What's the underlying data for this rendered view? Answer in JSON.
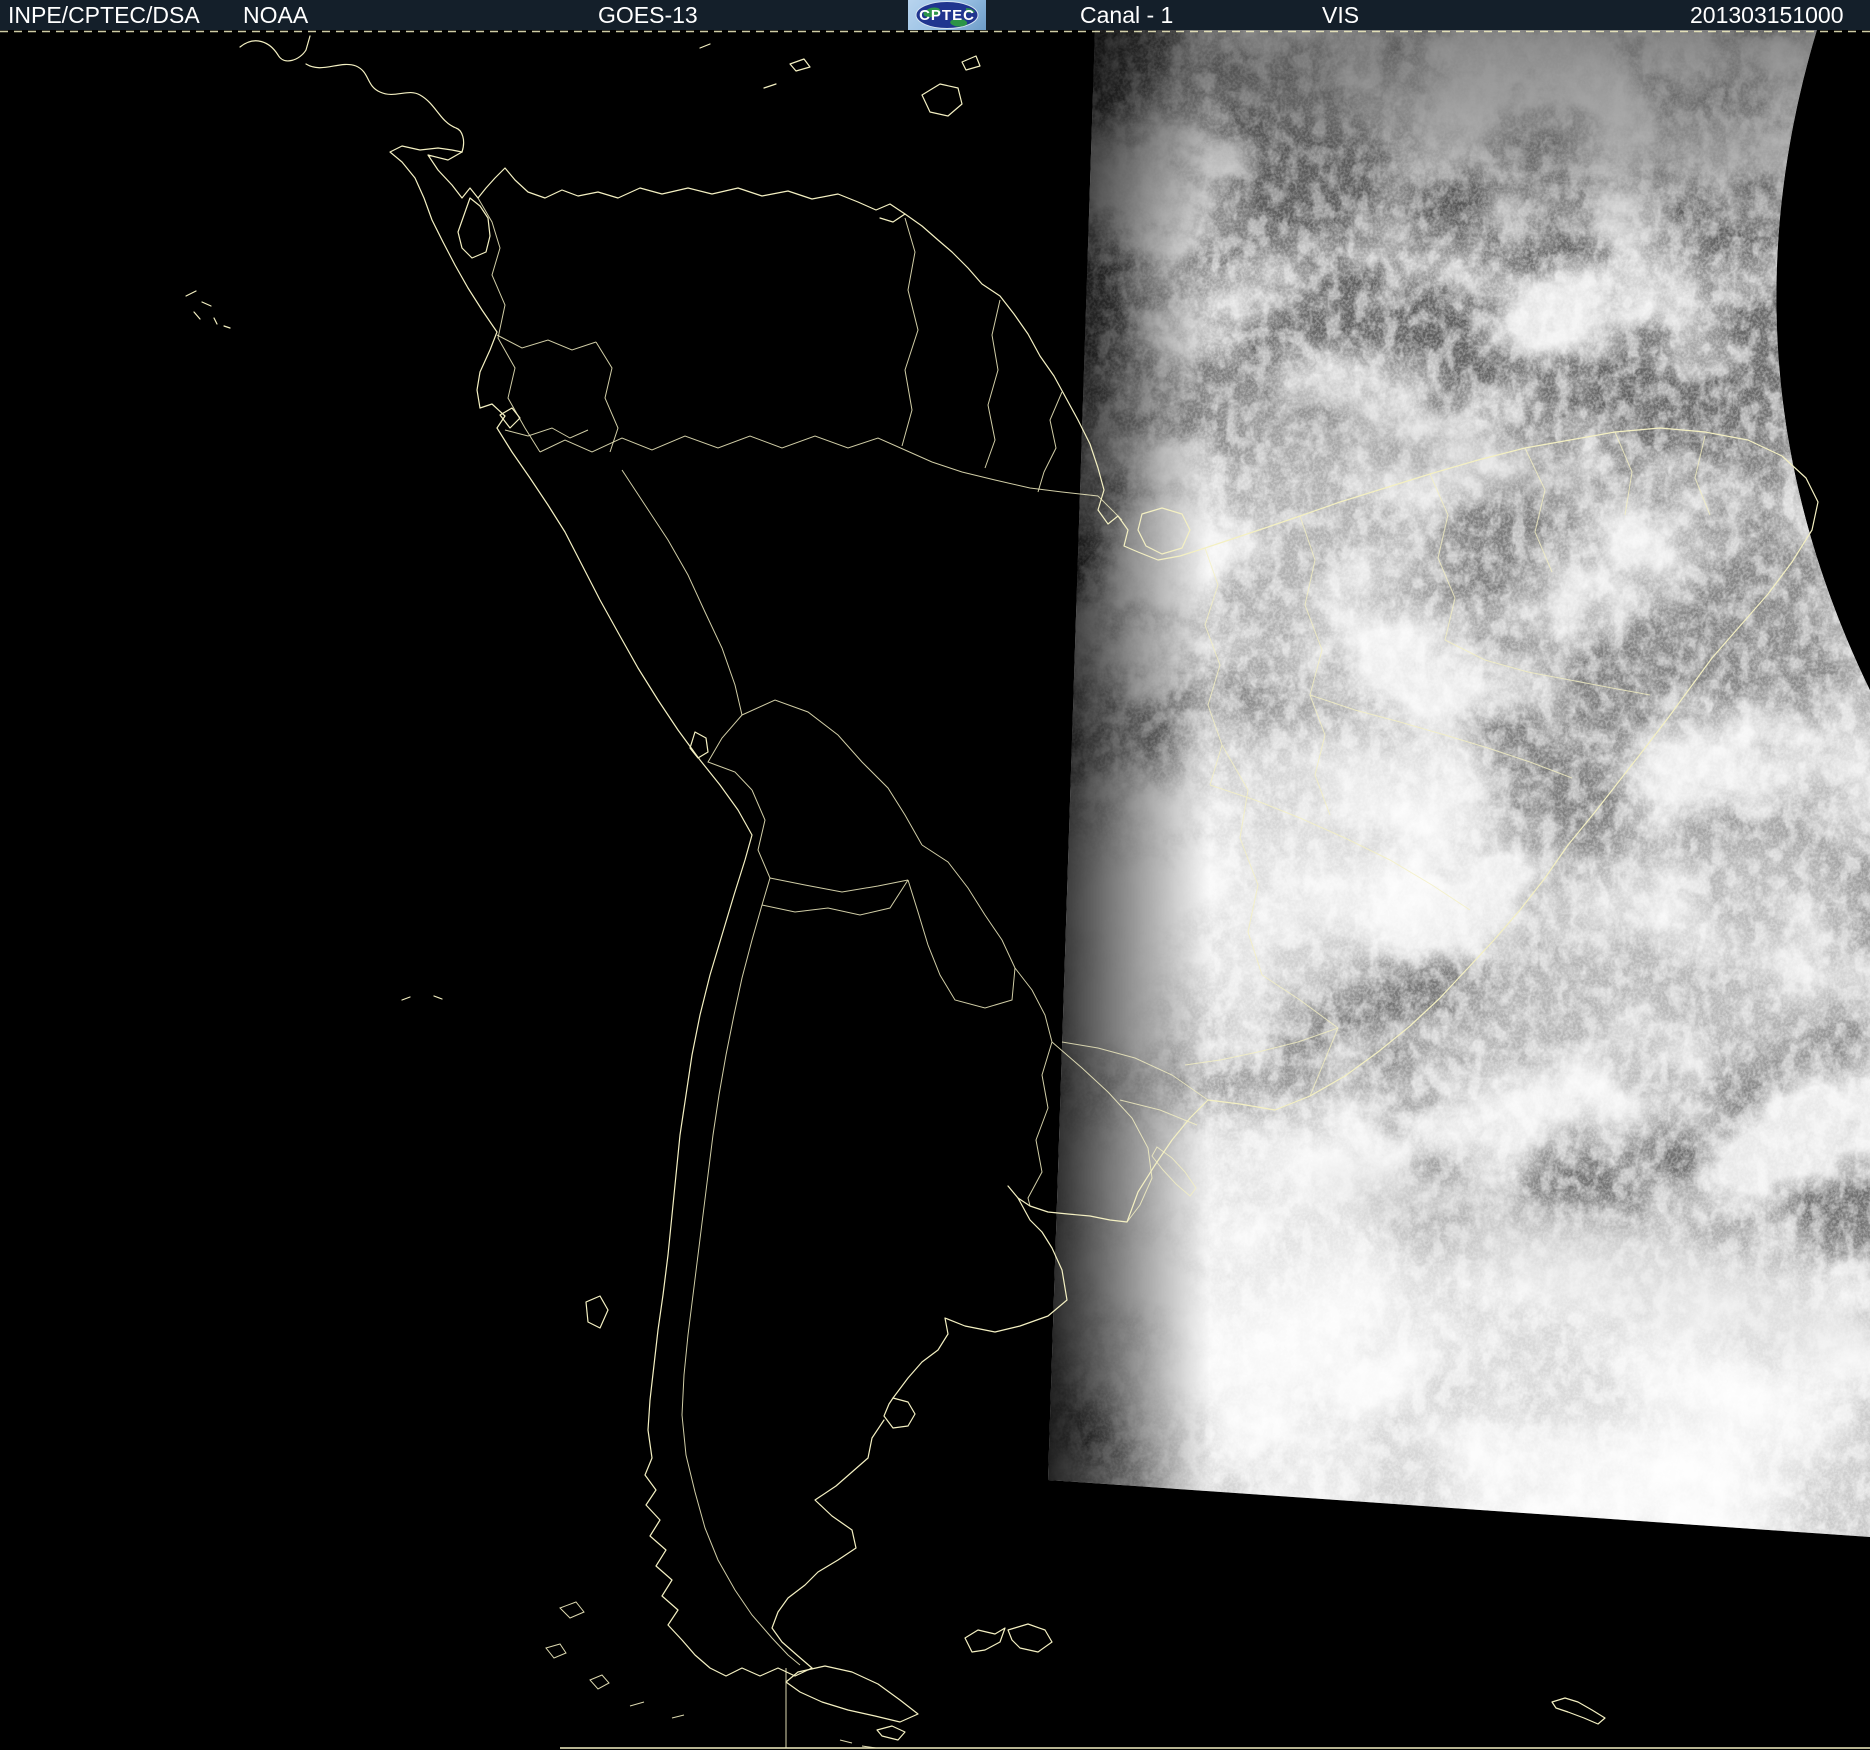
{
  "header": {
    "institution": "INPE/CPTEC/DSA",
    "agency": "NOAA",
    "satellite": "GOES-13",
    "logo_text": "CPTEC",
    "channel_label": "Canal - 1",
    "channel_type": "VIS",
    "datetime": "201303151000"
  },
  "colors": {
    "header_bg": "#141f2a",
    "header_text": "#ffffff",
    "map_outline": "#f4f0c2",
    "background": "#000000",
    "logo_bg": "#9ec4e6",
    "logo_globe": "#20358f",
    "logo_land": "#2e9e40"
  },
  "map": {
    "overlay_features": [
      "central-america-coast",
      "south-america-coastline",
      "country-borders",
      "brazil-state-borders",
      "galapagos-islands",
      "lake-maracaibo",
      "marajo-island",
      "lake-titicaca",
      "chiloe-island",
      "falkland-islands",
      "south-georgia-island",
      "tierra-del-fuego",
      "caribbean-islands",
      "pacific-islets"
    ]
  },
  "imagery": {
    "kind": "visible-channel-satellite-swath",
    "coverage": "eastern-south-america-and-atlantic"
  }
}
